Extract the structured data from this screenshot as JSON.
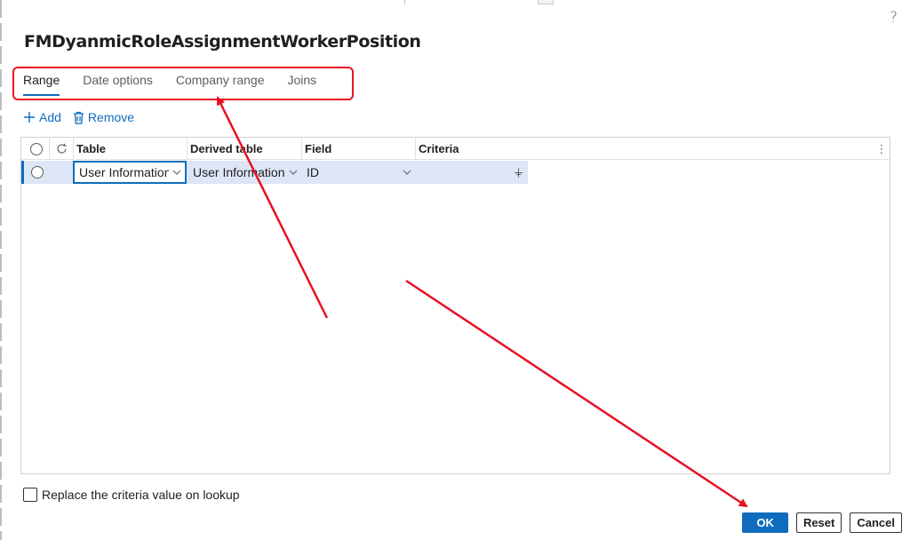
{
  "dialog": {
    "title": "FMDyanmicRoleAssignmentWorkerPosition",
    "help_label": "?"
  },
  "tabs": [
    {
      "label": "Range",
      "active": true
    },
    {
      "label": "Date options",
      "active": false
    },
    {
      "label": "Company range",
      "active": false
    },
    {
      "label": "Joins",
      "active": false
    }
  ],
  "toolbar": {
    "add_label": "Add",
    "remove_label": "Remove"
  },
  "grid": {
    "columns": [
      "Table",
      "Derived table",
      "Field",
      "Criteria"
    ],
    "rows": [
      {
        "table": "User Information",
        "derived_table": "User Information",
        "field": "ID",
        "criteria": ""
      }
    ]
  },
  "options": {
    "replace_criteria_label": "Replace the criteria value on lookup",
    "replace_criteria_checked": false
  },
  "footer": {
    "ok_label": "OK",
    "reset_label": "Reset",
    "cancel_label": "Cancel"
  },
  "colors": {
    "accent": "#0f6cbd",
    "annotation": "#e81123",
    "selected_row": "#dde6f7"
  },
  "icons": [
    "help-icon",
    "add-icon",
    "trash-icon",
    "refresh-icon",
    "chevron-down-icon",
    "more-icon",
    "column-resize-icon"
  ]
}
